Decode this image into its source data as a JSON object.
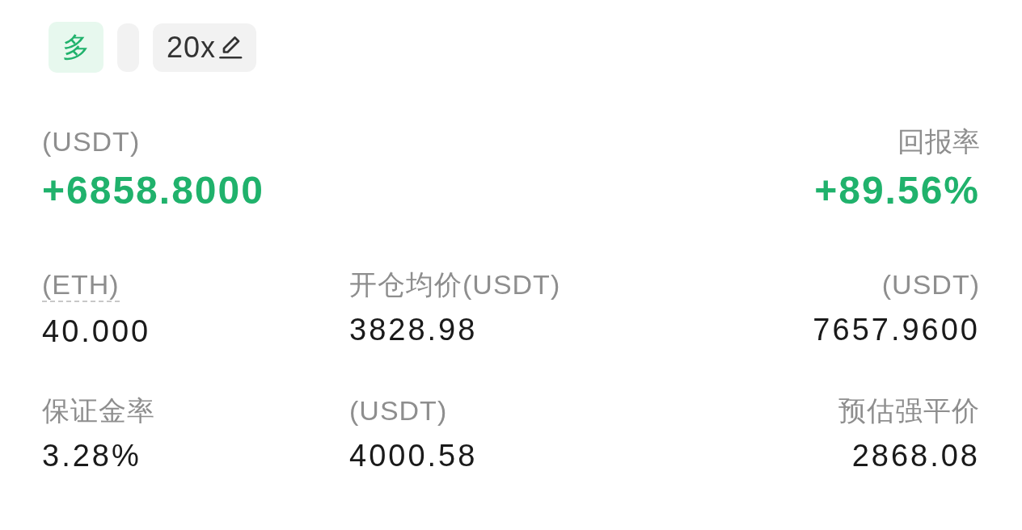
{
  "position": {
    "side": {
      "text": "多",
      "kind": "long"
    },
    "leverage": {
      "text": "20x",
      "editable": true
    }
  },
  "pnl": {
    "label": "(USDT)",
    "value": "+6858.8000"
  },
  "roe": {
    "label": "回报率",
    "value": "+89.56%"
  },
  "stats": [
    {
      "label": "(ETH)",
      "value": "40.000",
      "dotted_underline": true
    },
    {
      "label": "开仓均价(USDT)",
      "value": "3828.98",
      "dotted_underline": false
    },
    {
      "label": "(USDT)",
      "value": "7657.9600",
      "dotted_underline": false
    },
    {
      "label": "保证金率",
      "value": "3.28%",
      "dotted_underline": false
    },
    {
      "label": "(USDT)",
      "value": "4000.58",
      "dotted_underline": false
    },
    {
      "label": "预估强平价",
      "value": "2868.08",
      "dotted_underline": false
    }
  ]
}
